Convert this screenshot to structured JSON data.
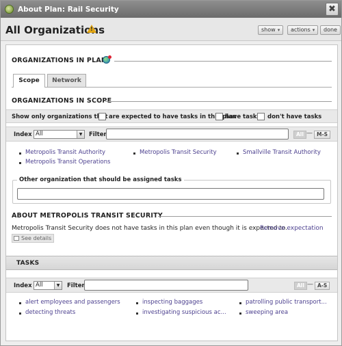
{
  "window": {
    "title": "About Plan: Rail Security",
    "close_glyph": "✖"
  },
  "header": {
    "title": "All Organizations",
    "warning_glyph": "!",
    "buttons": {
      "show": "show",
      "actions": "actions",
      "done": "done"
    }
  },
  "orgs_in_plan": {
    "heading": "ORGANIZATIONS IN PLAN",
    "tabs": [
      "Scope",
      "Network"
    ],
    "active_tab": "Scope"
  },
  "scope": {
    "heading": "ORGANIZATIONS IN SCOPE",
    "filter_prefix": "Show only organizations that",
    "options": [
      "are expected to have tasks in this plan",
      "have tasks",
      "don't have tasks"
    ],
    "index_label": "Index",
    "index_value": "All",
    "filter_label": "Filter:",
    "range_all": "All",
    "range_sep": "—",
    "range_letters": "M-S",
    "organizations": [
      "Metropolis Transit Authority",
      "Metropolis Transit Operations",
      "Metropolis Transit Security",
      "Smallville Transit Authority"
    ]
  },
  "other_org": {
    "legend": "Other organization that should be assigned tasks",
    "value": ""
  },
  "about": {
    "heading": "ABOUT METROPOLIS TRANSIT SECURITY",
    "message": "Metropolis Transit Security does not have tasks in this plan even though it is expected to.",
    "remove_link": "Remove expectation",
    "details_button": "See details"
  },
  "tasks": {
    "heading": "TASKS",
    "index_label": "Index",
    "index_value": "All",
    "filter_label": "Filter:",
    "range_all": "All",
    "range_sep": "—",
    "range_letters": "A-S",
    "items": [
      "alert employees and passengers",
      "detecting threats",
      "inspecting baggages",
      "investigating suspicious ac...",
      "patrolling public transport...",
      "sweeping area"
    ]
  },
  "colors": {
    "title_bar": "#7a7a7a",
    "link": "#4b3f8e",
    "warning": "#e2a614"
  }
}
